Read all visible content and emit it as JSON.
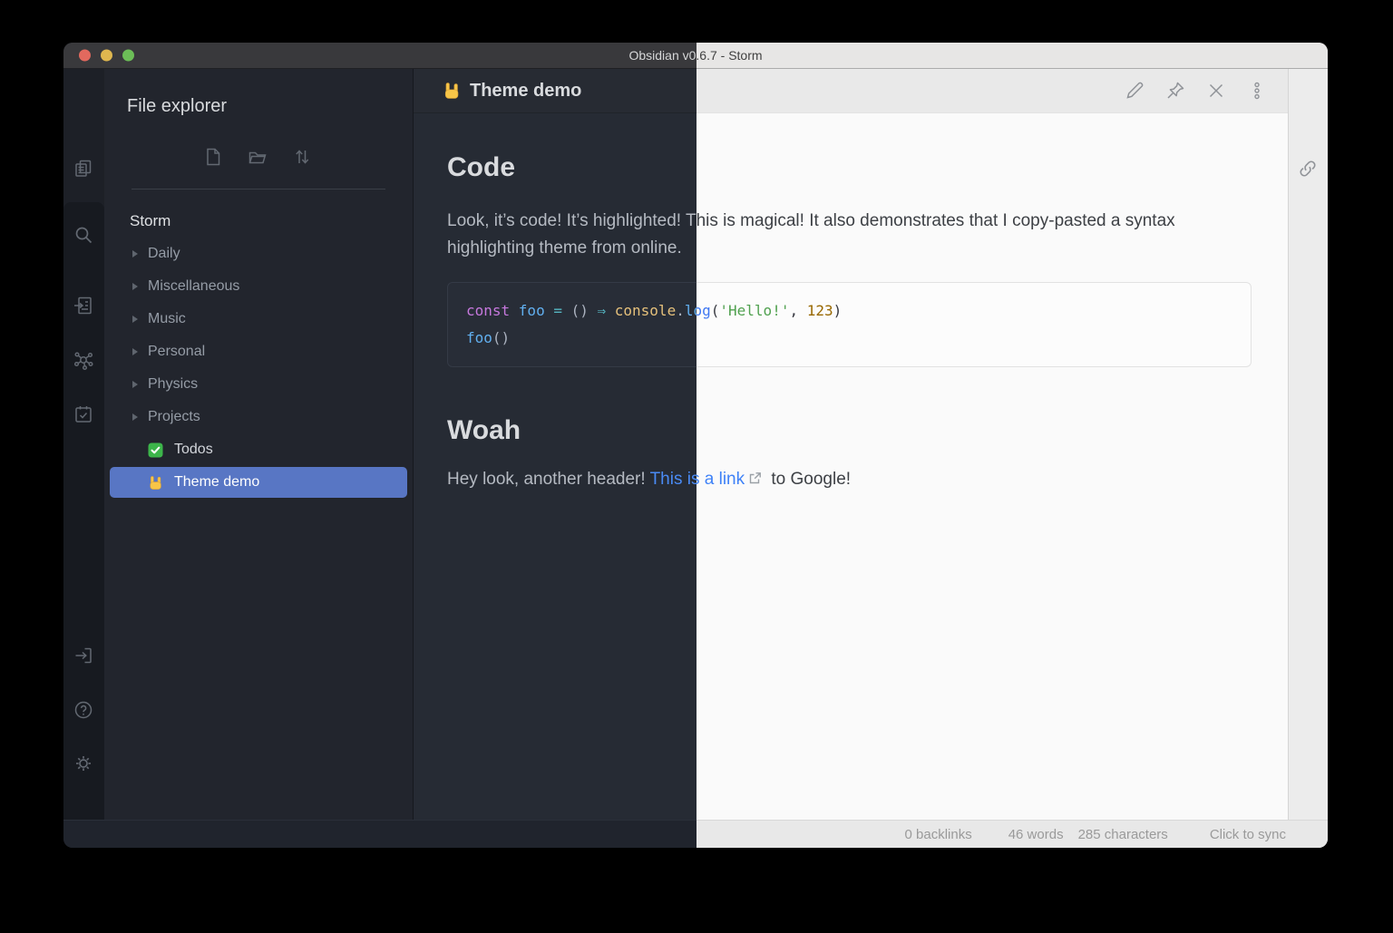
{
  "window": {
    "title": "Obsidian v0.6.7 - Storm"
  },
  "colors": {
    "selection_blue": "#5876c4",
    "link_blue": "#4a8bf5",
    "traffic_red": "#e2695e",
    "traffic_yellow": "#dfb74f",
    "traffic_green": "#6cbe57",
    "syntax_dark": {
      "keyword": "#c678dd",
      "function": "#61afef",
      "operator": "#56b6c2",
      "plain": "#abb2bf",
      "builtin": "#e5c07b",
      "string": "#98c379",
      "number": "#d19a66"
    },
    "syntax_light": {
      "keyword": "#a626a4",
      "function": "#4078f2",
      "operator": "#0184bc",
      "plain": "#383a42",
      "builtin": "#c18401",
      "string": "#50a14f",
      "number": "#986801"
    }
  },
  "ribbon": {
    "top_icons": [
      "files",
      "search",
      "open-note",
      "graph",
      "calendar-check"
    ],
    "bottom_icons": [
      "vault-switcher",
      "help",
      "settings"
    ]
  },
  "file_explorer": {
    "title": "File explorer",
    "toolbar_icons": [
      "new-note",
      "new-folder",
      "sort"
    ],
    "vault_name": "Storm",
    "folders": [
      "Daily",
      "Miscellaneous",
      "Music",
      "Personal",
      "Physics",
      "Projects"
    ],
    "files": [
      {
        "label": "Todos",
        "icon": "check-emoji",
        "selected": false
      },
      {
        "label": "Theme demo",
        "icon": "horns-emoji",
        "selected": true
      }
    ]
  },
  "pane": {
    "title": "Theme demo",
    "title_icon": "horns-emoji",
    "action_icons": [
      "edit",
      "pin",
      "close",
      "more-options"
    ],
    "heading1": "Code",
    "paragraph1": "Look, it’s code! It’s highlighted! This is magical! It also demonstrates that I copy-pasted a syntax highlighting theme from online.",
    "code": {
      "line1": [
        {
          "text": "const ",
          "style": "kw"
        },
        {
          "text": "foo ",
          "style": "fn"
        },
        {
          "text": "= ",
          "style": "op"
        },
        {
          "text": "() ",
          "style": "pl"
        },
        {
          "text": "⇒ ",
          "style": "op"
        },
        {
          "text": "console",
          "style": "bi"
        },
        {
          "text": ".",
          "style": "pl"
        },
        {
          "text": "log",
          "style": "fn"
        },
        {
          "text": "(",
          "style": "pl"
        },
        {
          "text": "'Hello!'",
          "style": "str"
        },
        {
          "text": ", ",
          "style": "pl"
        },
        {
          "text": "123",
          "style": "num"
        },
        {
          "text": ")",
          "style": "pl"
        }
      ],
      "line2": [
        {
          "text": "foo",
          "style": "fn"
        },
        {
          "text": "()",
          "style": "pl"
        }
      ]
    },
    "heading2": "Woah",
    "line": {
      "pre": "Hey look, another header! ",
      "link": "This is a link",
      "post": " to Google!"
    }
  },
  "right_sidebar": {
    "icons": [
      "link"
    ]
  },
  "status_bar": {
    "backlinks": "0 backlinks",
    "words": "46 words",
    "characters": "285 characters",
    "sync": "Click to sync"
  }
}
